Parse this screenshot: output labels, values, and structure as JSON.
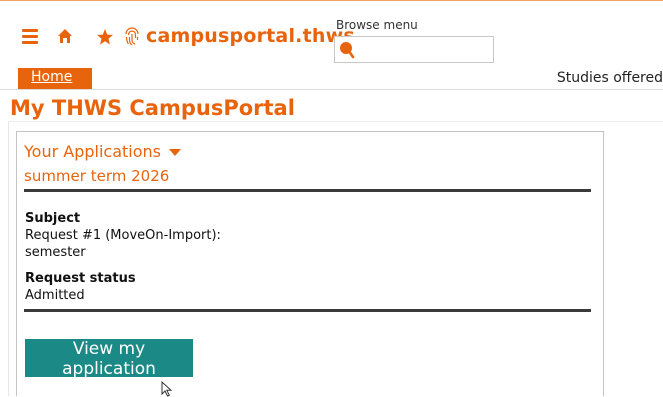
{
  "header": {
    "menu_icon": "hamburger-menu-icon",
    "home_icon": "home-icon",
    "favorite_icon": "star-icon",
    "logo_icon": "fingerprint-logo-icon",
    "site_title": "campusportal.thws",
    "browse_menu": {
      "label": "Browse menu",
      "value": "",
      "icon": "search-icon"
    }
  },
  "nav": {
    "home_label": "Home",
    "studies_label": "Studies offered"
  },
  "page": {
    "title": "My THWS CampusPortal"
  },
  "applications": {
    "heading": "Your Applications",
    "term": "summer term 2026",
    "subject_label": "Subject",
    "subject_value_line1": "Request #1 (MoveOn-Import):",
    "subject_value_line2": "semester",
    "status_label": "Request status",
    "status_value": "Admitted",
    "view_button": "View my application"
  },
  "colors": {
    "brand_orange": "#e8640c",
    "button_teal": "#1b8a87",
    "divider_dark": "#3a3a3a"
  }
}
